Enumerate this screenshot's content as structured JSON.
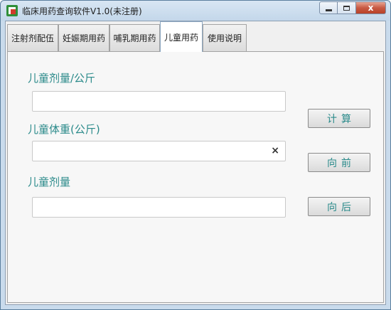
{
  "window": {
    "title": "临床用药查询软件V1.0(未注册)",
    "controls": {
      "close_glyph": "x"
    }
  },
  "tabs": [
    {
      "label": "注射剂配伍",
      "active": false
    },
    {
      "label": "妊娠期用药",
      "active": false
    },
    {
      "label": "哺乳期用药",
      "active": false
    },
    {
      "label": "儿童用药",
      "active": true
    },
    {
      "label": "使用说明",
      "active": false
    }
  ],
  "panel": {
    "dose_per_kg_label": "儿童剂量/公斤",
    "dose_per_kg_value": "",
    "weight_label": "儿童体重(公斤)",
    "weight_value": "",
    "weight_clear_glyph": "×",
    "child_dose_label": "儿童剂量",
    "child_dose_value": "",
    "calc_button": "计算",
    "prev_button": "向前",
    "next_button": "向后"
  },
  "colors": {
    "label_teal": "#2a8a8a",
    "close_red": "#c85a43"
  }
}
